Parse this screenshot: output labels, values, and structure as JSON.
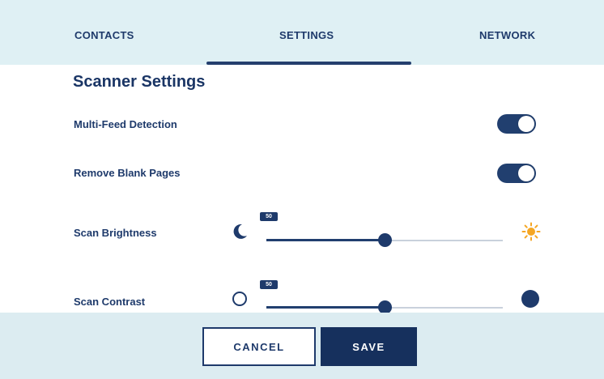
{
  "tabs": {
    "contacts": "CONTACTS",
    "settings": "SETTINGS",
    "network": "NETWORK",
    "active": "SETTINGS"
  },
  "section": {
    "title": "Scanner Settings"
  },
  "settings": {
    "multi_feed": {
      "label": "Multi-Feed Detection",
      "enabled": true
    },
    "remove_blank": {
      "label": "Remove Blank Pages",
      "enabled": true
    },
    "brightness": {
      "label": "Scan Brightness",
      "value": 50,
      "badge": "50",
      "min_icon": "moon-icon",
      "max_icon": "sun-icon"
    },
    "contrast": {
      "label": "Scan Contrast",
      "value": 50,
      "badge": "50",
      "min_icon": "empty-circle-icon",
      "max_icon": "filled-circle-icon"
    }
  },
  "buttons": {
    "cancel": "CANCEL",
    "save": "SAVE"
  },
  "colors": {
    "accent": "#1e3a6b",
    "tab_bar_bg": "#dff0f4",
    "sun": "#f5a623"
  }
}
